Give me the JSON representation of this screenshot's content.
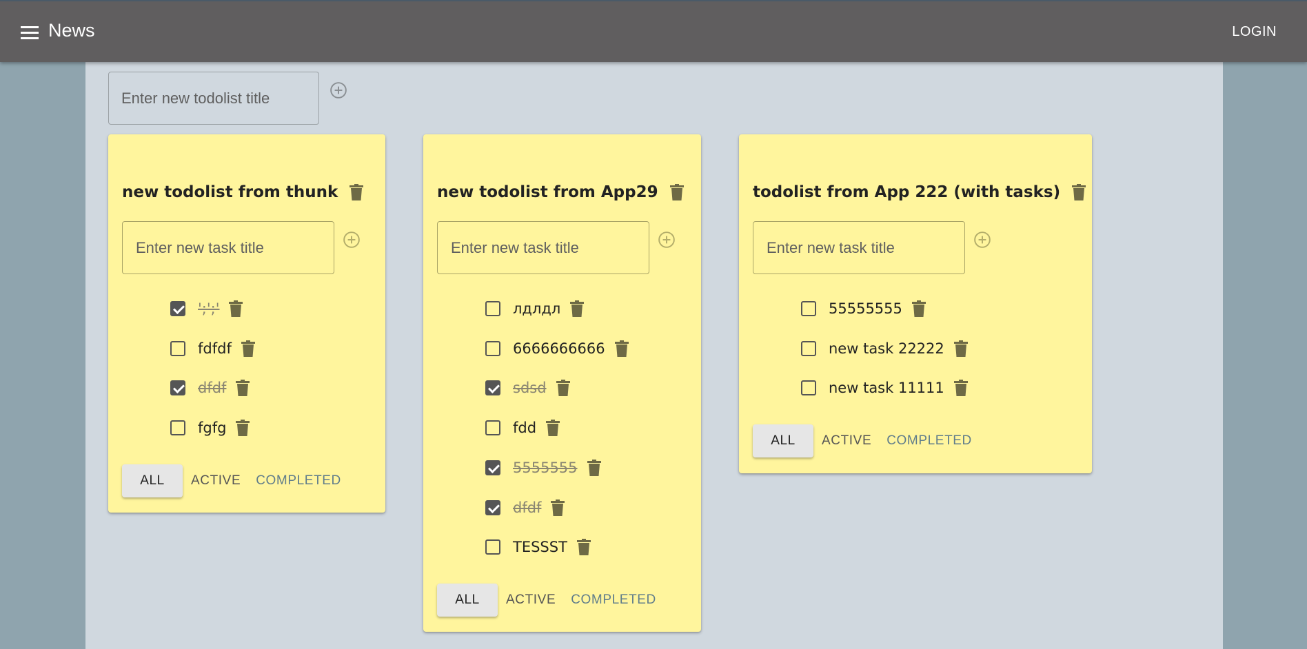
{
  "appbar": {
    "title": "News",
    "login_label": "LOGIN"
  },
  "new_todolist": {
    "placeholder": "Enter new todolist title"
  },
  "todolists": [
    {
      "title": "new todolist from thunk",
      "task_placeholder": "Enter new task title",
      "tasks": [
        {
          "title": "';';'",
          "done": true
        },
        {
          "title": "fdfdf",
          "done": false
        },
        {
          "title": "dfdf",
          "done": true
        },
        {
          "title": "fgfg",
          "done": false
        }
      ],
      "filters": {
        "all": "ALL",
        "active": "ACTIVE",
        "completed": "COMPLETED"
      }
    },
    {
      "title": "new todolist from App29",
      "task_placeholder": "Enter new task title",
      "tasks": [
        {
          "title": "лдлдл",
          "done": false
        },
        {
          "title": "6666666666",
          "done": false
        },
        {
          "title": "sdsd",
          "done": true
        },
        {
          "title": "fdd",
          "done": false
        },
        {
          "title": "5555555",
          "done": true
        },
        {
          "title": "dfdf",
          "done": true
        },
        {
          "title": "TESSST",
          "done": false
        }
      ],
      "filters": {
        "all": "ALL",
        "active": "ACTIVE",
        "completed": "COMPLETED"
      }
    },
    {
      "title": "todolist from App 222 (with tasks)",
      "task_placeholder": "Enter new task title",
      "tasks": [
        {
          "title": "55555555",
          "done": false
        },
        {
          "title": "new task 22222",
          "done": false
        },
        {
          "title": "new task 11111",
          "done": false
        }
      ],
      "filters": {
        "all": "ALL",
        "active": "ACTIVE",
        "completed": "COMPLETED"
      }
    }
  ],
  "colors": {
    "appbar": "#605e5f",
    "card": "#fff59d",
    "accent": "#607d8b",
    "background": "#d0d8df"
  },
  "icons": {
    "menu": "hamburger-icon",
    "add": "add-circle-icon",
    "delete": "trash-icon",
    "checkbox": "checkbox-icon"
  }
}
